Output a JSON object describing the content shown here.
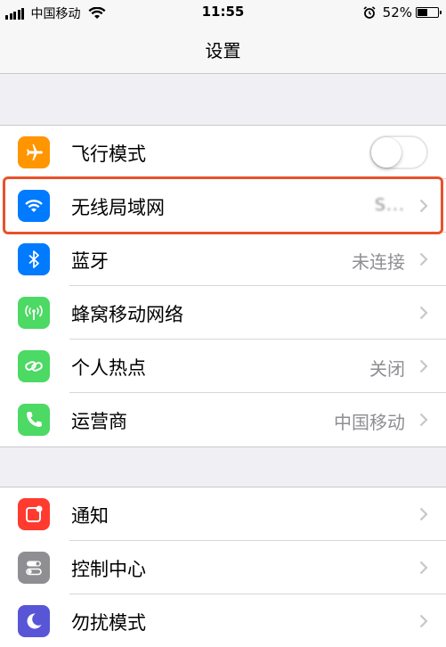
{
  "status_bar": {
    "carrier": "中国移动",
    "time": "11:55",
    "battery_percent": "52%",
    "battery_level": 0.52
  },
  "nav": {
    "title": "设置"
  },
  "group1": [
    {
      "label": "飞行模式",
      "icon": "airplane-icon",
      "icon_color": "#ff9500",
      "toggle": false
    },
    {
      "label": "无线局域网",
      "icon": "wifi-icon",
      "icon_color": "#007aff",
      "value": "S...",
      "highlighted": true
    },
    {
      "label": "蓝牙",
      "icon": "bluetooth-icon",
      "icon_color": "#007aff",
      "value": "未连接"
    },
    {
      "label": "蜂窝移动网络",
      "icon": "cellular-antenna-icon",
      "icon_color": "#4cd964",
      "value": ""
    },
    {
      "label": "个人热点",
      "icon": "hotspot-chain-icon",
      "icon_color": "#4cd964",
      "value": "关闭"
    },
    {
      "label": "运营商",
      "icon": "phone-icon",
      "icon_color": "#4cd964",
      "value": "中国移动"
    }
  ],
  "group2": [
    {
      "label": "通知",
      "icon": "notifications-icon",
      "icon_color": "#ff3b30"
    },
    {
      "label": "控制中心",
      "icon": "control-center-icon",
      "icon_color": "#8e8e93"
    },
    {
      "label": "勿扰模式",
      "icon": "moon-icon",
      "icon_color": "#5856d6"
    }
  ],
  "highlight_color": "#e8522a"
}
